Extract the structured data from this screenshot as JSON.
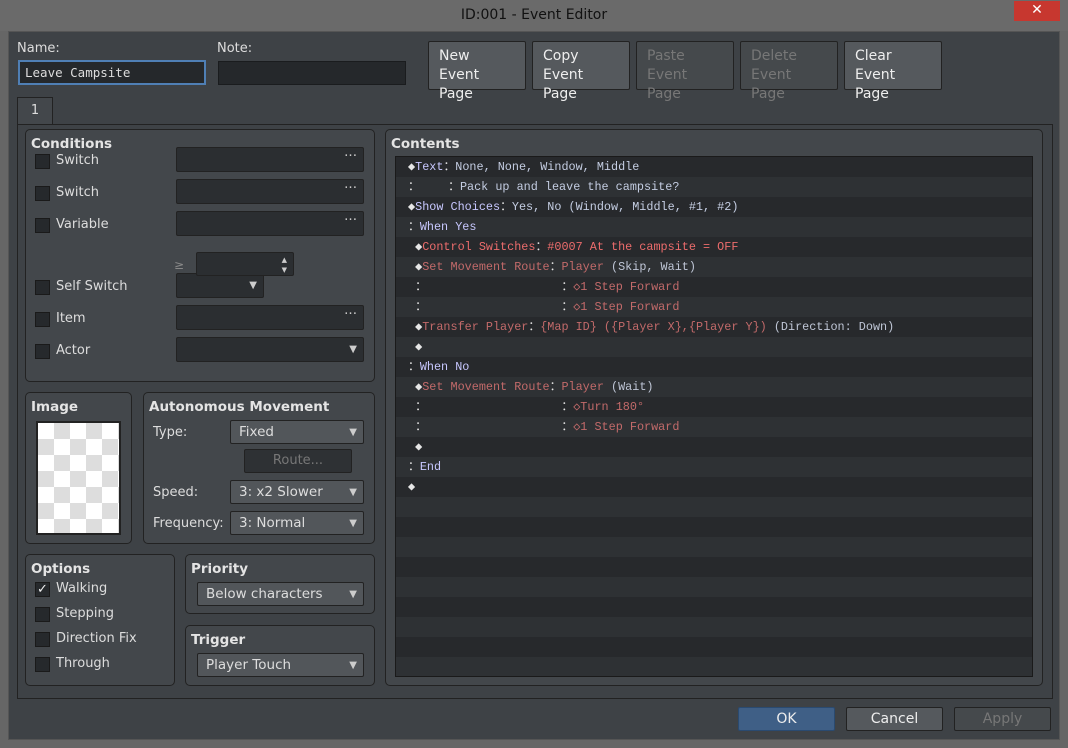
{
  "window": {
    "title": "ID:001 - Event Editor",
    "close": "✕"
  },
  "name": {
    "label": "Name:",
    "value": "Leave Campsite"
  },
  "note": {
    "label": "Note:",
    "value": ""
  },
  "toolbar": [
    {
      "l1": "New",
      "l2": "Event Page",
      "enabled": true
    },
    {
      "l1": "Copy",
      "l2": "Event Page",
      "enabled": true
    },
    {
      "l1": "Paste",
      "l2": "Event Page",
      "enabled": false
    },
    {
      "l1": "Delete",
      "l2": "Event Page",
      "enabled": false
    },
    {
      "l1": "Clear",
      "l2": "Event Page",
      "enabled": true
    }
  ],
  "tab": "1",
  "conditions": {
    "title": "Conditions",
    "items": [
      {
        "label": "Switch",
        "kind": "dots"
      },
      {
        "label": "Switch",
        "kind": "dots"
      },
      {
        "label": "Variable",
        "kind": "dots"
      },
      {
        "label": "Self Switch",
        "kind": "combo"
      },
      {
        "label": "Item",
        "kind": "dots"
      },
      {
        "label": "Actor",
        "kind": "combo"
      }
    ],
    "ge": "≥",
    "dots": "···"
  },
  "image": {
    "title": "Image"
  },
  "movement": {
    "title": "Autonomous Movement",
    "type_label": "Type:",
    "type": "Fixed",
    "route": "Route...",
    "speed_label": "Speed:",
    "speed": "3: x2 Slower",
    "freq_label": "Frequency:",
    "freq": "3: Normal"
  },
  "options": {
    "title": "Options",
    "items": [
      {
        "label": "Walking",
        "checked": true
      },
      {
        "label": "Stepping",
        "checked": false
      },
      {
        "label": "Direction Fix",
        "checked": false
      },
      {
        "label": "Through",
        "checked": false
      }
    ]
  },
  "priority": {
    "title": "Priority",
    "value": "Below characters"
  },
  "trigger": {
    "title": "Trigger",
    "value": "Player Touch"
  },
  "contents": {
    "title": "Contents",
    "lines": [
      [
        [
          "d",
          "◆"
        ],
        [
          "cmd",
          "Text"
        ],
        [
          "d",
          "："
        ],
        [
          "p",
          "None, None, Window, Middle"
        ]
      ],
      [
        [
          "d",
          "："
        ],
        [
          "d",
          "    ："
        ],
        [
          "p",
          "Pack up and leave the campsite?"
        ]
      ],
      [
        [
          "d",
          "◆"
        ],
        [
          "cmd",
          "Show Choices"
        ],
        [
          "d",
          "："
        ],
        [
          "p",
          "Yes, No (Window, Middle, #1, #2)"
        ]
      ],
      [
        [
          "d",
          "："
        ],
        [
          "cmd",
          "When Yes"
        ]
      ],
      [
        [
          "d",
          " ◆"
        ],
        [
          "r",
          "Control Switches"
        ],
        [
          "d",
          "："
        ],
        [
          "r",
          "#0007 At the campsite = OFF"
        ]
      ],
      [
        [
          "d",
          " ◆"
        ],
        [
          "m",
          "Set Movement Route"
        ],
        [
          "d",
          "："
        ],
        [
          "m",
          "Player "
        ],
        [
          "g",
          "(Skip, Wait)"
        ]
      ],
      [
        [
          "d",
          " ："
        ],
        [
          "d",
          "                   ："
        ],
        [
          "m",
          "◇1 Step Forward"
        ]
      ],
      [
        [
          "d",
          " ："
        ],
        [
          "d",
          "                   ："
        ],
        [
          "m",
          "◇1 Step Forward"
        ]
      ],
      [
        [
          "d",
          " ◆"
        ],
        [
          "m",
          "Transfer Player"
        ],
        [
          "d",
          "："
        ],
        [
          "m",
          "{Map ID} ({Player X},{Player Y}) "
        ],
        [
          "g",
          "(Direction: Down)"
        ]
      ],
      [
        [
          "d",
          " ◆"
        ]
      ],
      [
        [
          "d",
          "："
        ],
        [
          "cmd",
          "When No"
        ]
      ],
      [
        [
          "d",
          " ◆"
        ],
        [
          "m",
          "Set Movement Route"
        ],
        [
          "d",
          "："
        ],
        [
          "m",
          "Player "
        ],
        [
          "g",
          "(Wait)"
        ]
      ],
      [
        [
          "d",
          " ："
        ],
        [
          "d",
          "                   ："
        ],
        [
          "m",
          "◇Turn 180°"
        ]
      ],
      [
        [
          "d",
          " ："
        ],
        [
          "d",
          "                   ："
        ],
        [
          "m",
          "◇1 Step Forward"
        ]
      ],
      [
        [
          "d",
          " ◆"
        ]
      ],
      [
        [
          "d",
          "："
        ],
        [
          "cmd",
          "End"
        ]
      ],
      [
        [
          "d",
          "◆"
        ]
      ]
    ]
  },
  "footer": {
    "ok": "OK",
    "cancel": "Cancel",
    "apply": "Apply"
  }
}
